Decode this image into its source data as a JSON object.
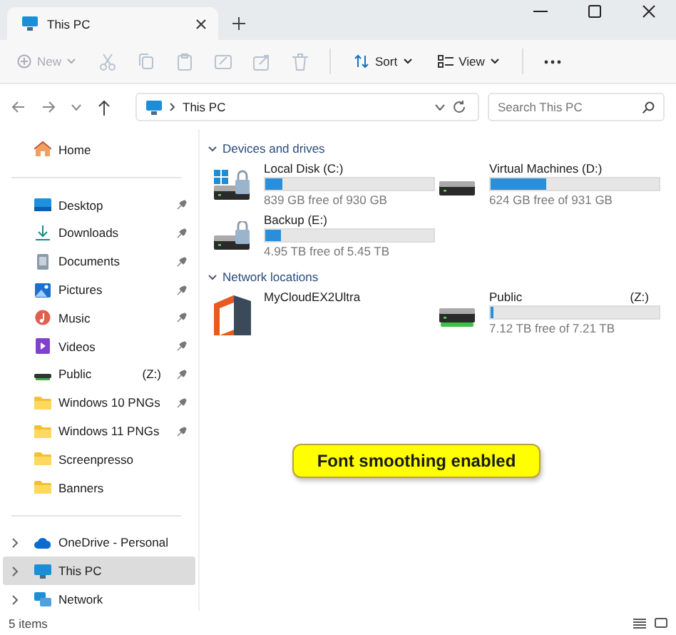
{
  "tabs": [
    {
      "title": "This PC",
      "selected": true
    }
  ],
  "toolbar": [
    {
      "kind": "new",
      "label": "New",
      "disabled": true
    },
    {
      "kind": "cut",
      "disabled": true
    },
    {
      "kind": "copy",
      "disabled": true
    },
    {
      "kind": "paste",
      "disabled": true
    },
    {
      "kind": "rename",
      "disabled": true
    },
    {
      "kind": "share",
      "disabled": true
    },
    {
      "kind": "delete",
      "disabled": true
    },
    {
      "kind": "sort",
      "label": "Sort",
      "disabled": false
    },
    {
      "kind": "view",
      "label": "View",
      "disabled": false
    },
    {
      "kind": "more",
      "disabled": false
    }
  ],
  "address_bar": {
    "path": "This PC"
  },
  "search": {
    "placeholder": "Search This PC"
  },
  "sidebar": {
    "sections": [
      {
        "items": [
          {
            "kind": "home",
            "label": "Home",
            "pinned": false,
            "selected": false
          }
        ]
      },
      {
        "items": [
          {
            "kind": "desktop",
            "label": "Desktop",
            "pinned": true,
            "selected": false
          },
          {
            "kind": "downloads",
            "label": "Downloads",
            "pinned": true,
            "selected": false
          },
          {
            "kind": "documents",
            "label": "Documents",
            "pinned": true,
            "selected": false
          },
          {
            "kind": "pictures",
            "label": "Pictures",
            "pinned": true,
            "selected": false
          },
          {
            "kind": "music",
            "label": "Music",
            "pinned": true,
            "selected": false
          },
          {
            "kind": "videos",
            "label": "Videos",
            "pinned": true,
            "selected": false
          },
          {
            "kind": "drive",
            "label": "Public",
            "letter": "(Z:)",
            "pinned": true,
            "selected": false
          },
          {
            "kind": "folder",
            "label": "Windows 10 PNGs",
            "pinned": true,
            "selected": false
          },
          {
            "kind": "folder",
            "label": "Windows 11 PNGs",
            "pinned": true,
            "selected": false
          },
          {
            "kind": "folder",
            "label": "Screenpresso",
            "pinned": false,
            "selected": false
          },
          {
            "kind": "folder",
            "label": "Banners",
            "pinned": false,
            "selected": false
          }
        ]
      },
      {
        "items": [
          {
            "kind": "cloud",
            "label": "OneDrive - Personal",
            "expanded": false,
            "pinned": false,
            "selected": false
          },
          {
            "kind": "pc",
            "label": "This PC",
            "expanded": false,
            "pinned": false,
            "selected": true
          },
          {
            "kind": "network",
            "label": "Network",
            "expanded": false,
            "pinned": false,
            "selected": false
          }
        ]
      }
    ]
  },
  "content": {
    "groups": [
      {
        "title": "Devices and drives",
        "expanded": true,
        "items": [
          {
            "kind": "system",
            "name": "Local Disk (C:)",
            "level": 0.1,
            "free": "839 GB free of 930 GB"
          },
          {
            "kind": "hdd",
            "name": "Virtual Machines (D:)",
            "level": 0.33,
            "free": "624 GB free of 931 GB"
          },
          {
            "kind": "locked",
            "name": "Backup (E:)",
            "level": 0.09,
            "free": "4.95 TB free of 5.45 TB"
          }
        ]
      },
      {
        "title": "Network locations",
        "expanded": true,
        "items": [
          {
            "kind": "nas",
            "name": "MyCloudEX2Ultra"
          },
          {
            "kind": "network",
            "name": "Public",
            "letter": "(Z:)",
            "level": 0.013,
            "free": "7.12 TB free of 7.21 TB"
          }
        ]
      }
    ]
  },
  "annotation": "Font smoothing enabled",
  "status_bar": {
    "count": "5 items"
  }
}
